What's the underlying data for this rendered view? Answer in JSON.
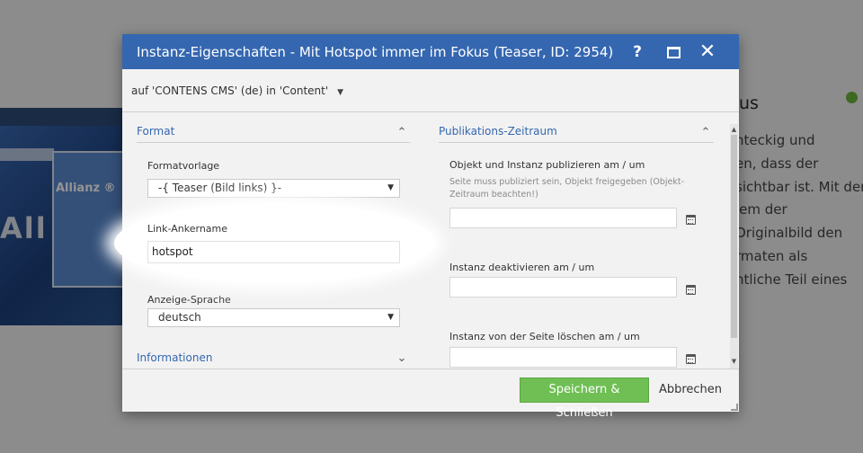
{
  "background": {
    "image_texts": {
      "brand": "Allianz ®",
      "large": "All"
    },
    "heading": "us",
    "lines": [
      "hteckig und",
      "en, dass der",
      "sichtbar ist. Mit der",
      "lem der",
      "Originalbild den",
      "rmaten als",
      "ntliche Teil eines"
    ],
    "dot_color": "#6bb53c"
  },
  "dialog": {
    "title": "Instanz-Eigenschaften - Mit Hotspot immer im Fokus (Teaser, ID: 2954)",
    "help_glyph": "?",
    "close_glyph": "✕",
    "location": "auf 'CONTENS CMS' (de) in 'Content'",
    "caret_glyph": "▼",
    "accent_color": "#3567b0",
    "left_panel": {
      "section_title": "Format",
      "format_template": {
        "label": "Formatvorlage",
        "value": "-{ Teaser (Bild links) }-"
      },
      "anchor_name": {
        "label": "Link-Ankername",
        "value": "hotspot"
      },
      "display_language": {
        "label": "Anzeige-Sprache",
        "value": "deutsch"
      },
      "info_section_title": "Informationen"
    },
    "right_panel": {
      "section_title": "Publikations-Zeitraum",
      "publish": {
        "label": "Objekt und Instanz publizieren am / um",
        "hint": "Seite muss publiziert sein, Objekt freigegeben (Objekt-Zeitraum beachten!)"
      },
      "deactivate": {
        "label": "Instanz deaktivieren am / um"
      },
      "delete": {
        "label": "Instanz von der Seite löschen am / um"
      }
    },
    "chevron_up": "⌃",
    "chevron_down": "⌄",
    "scroll_up": "▲",
    "scroll_down": "▼",
    "footer": {
      "save_label": "Speichern & Schließen",
      "cancel_label": "Abbrechen",
      "save_color": "#6fbf54"
    }
  }
}
